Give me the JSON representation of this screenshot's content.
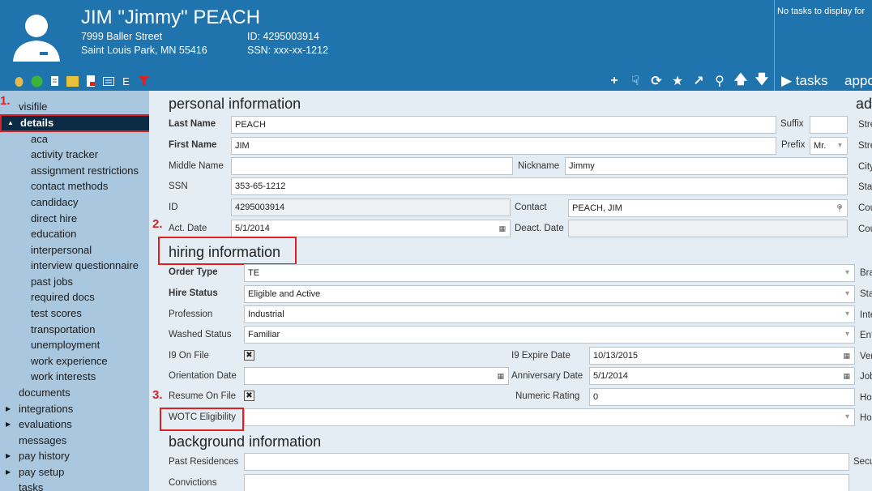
{
  "header": {
    "name": "JIM \"Jimmy\" PEACH",
    "address_line1": "7999 Baller Street",
    "address_line2": "Saint Louis Park, MN 55416",
    "id_line": "ID: 4295003914",
    "ssn_line": "SSN: xxx-xx-1212",
    "no_tasks": "No tasks to display for",
    "tasks_tab": "▶ tasks",
    "appo_tab": "appo",
    "toolbar_letter": "E"
  },
  "sidebar": {
    "marker1": "1.",
    "items": [
      {
        "label": "visifile"
      },
      {
        "label": "details"
      },
      {
        "label": "aca"
      },
      {
        "label": "activity tracker"
      },
      {
        "label": "assignment restrictions"
      },
      {
        "label": "contact methods"
      },
      {
        "label": "candidacy"
      },
      {
        "label": "direct hire"
      },
      {
        "label": "education"
      },
      {
        "label": "interpersonal"
      },
      {
        "label": "interview questionnaire"
      },
      {
        "label": "past jobs"
      },
      {
        "label": "required docs"
      },
      {
        "label": "test scores"
      },
      {
        "label": "transportation"
      },
      {
        "label": "unemployment"
      },
      {
        "label": "work experience"
      },
      {
        "label": "work interests"
      },
      {
        "label": "documents"
      },
      {
        "label": "integrations"
      },
      {
        "label": "evaluations"
      },
      {
        "label": "messages"
      },
      {
        "label": "pay history"
      },
      {
        "label": "pay setup"
      },
      {
        "label": "tasks"
      }
    ]
  },
  "personal": {
    "title": "personal information",
    "last_name_label": "Last Name",
    "last_name": "PEACH",
    "suffix_label": "Suffix",
    "first_name_label": "First Name",
    "first_name": "JIM",
    "prefix_label": "Prefix",
    "prefix": "Mr.",
    "middle_name_label": "Middle Name",
    "nickname_label": "Nickname",
    "nickname": "Jimmy",
    "ssn_label": "SSN",
    "ssn": "353-65-1212",
    "id_label": "ID",
    "id": "4295003914",
    "contact_label": "Contact",
    "contact": "PEACH, JIM",
    "act_date_label": "Act. Date",
    "act_date": "5/1/2014",
    "deact_date_label": "Deact. Date",
    "marker2": "2."
  },
  "hiring": {
    "title": "hiring information",
    "order_type_label": "Order Type",
    "order_type": "TE",
    "hire_status_label": "Hire Status",
    "hire_status": "Eligible and Active",
    "profession_label": "Profession",
    "profession": "Industrial",
    "washed_status_label": "Washed Status",
    "washed_status": "Familiar",
    "i9_label": "I9 On File",
    "i9_expire_label": "I9 Expire Date",
    "i9_expire": "10/13/2015",
    "orientation_label": "Orientation Date",
    "anniversary_label": "Anniversary Date",
    "anniversary": "5/1/2014",
    "resume_label": "Resume On File",
    "numeric_rating_label": "Numeric Rating",
    "numeric_rating": "0",
    "wotc_label": "WOTC Eligibility",
    "marker3": "3."
  },
  "background": {
    "title": "background information",
    "past_residences_label": "Past Residences",
    "convictions_label": "Convictions"
  },
  "right_col": {
    "heading": "ad",
    "labels": [
      "Stre",
      "Stre",
      "City",
      "Stat",
      "Cou",
      "Cou",
      "Bra",
      "Sta",
      "Inte",
      "Ent",
      "Ver",
      "Job",
      "Ho",
      "Ho",
      "Secu"
    ]
  }
}
